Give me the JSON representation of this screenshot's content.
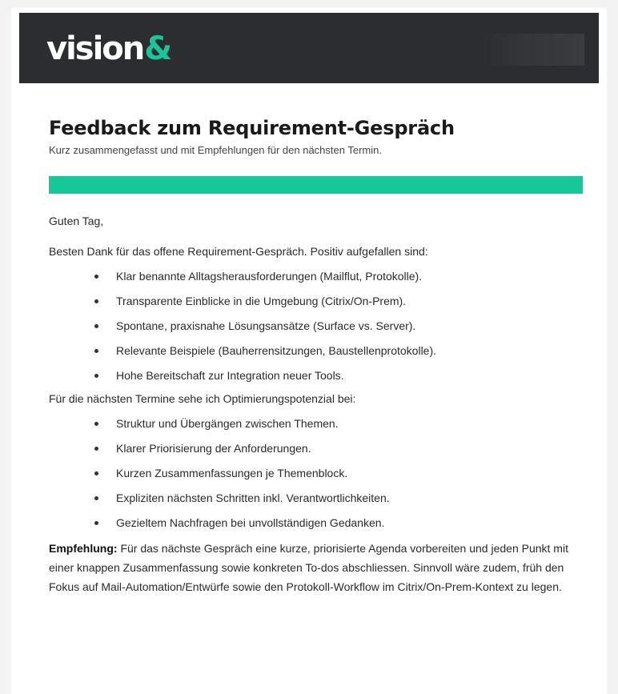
{
  "header": {
    "logo_text": "vision",
    "logo_amp": "&",
    "brand_color": "#16c79a",
    "banner_color": "#2b2d31"
  },
  "title": "Feedback zum Requirement-Gespräch",
  "subtitle": "Kurz zusammengefasst und mit Empfehlungen für den nächsten Termin.",
  "greeting": "Guten Tag,",
  "intro": "Besten Dank für das offene Requirement-Gespräch. Positiv aufgefallen sind:",
  "positives": [
    "Klar benannte Alltagsherausforderungen (Mailflut, Protokolle).",
    "Transparente Einblicke in die Umgebung (Citrix/On-Prem).",
    "Spontane, praxisnahe Lösungsansätze (Surface vs. Server).",
    "Relevante Beispiele (Bauherrensitzungen, Baustellenprotokolle).",
    "Hohe Bereitschaft zur Integration neuer Tools."
  ],
  "improvements_intro": "Für die nächsten Termine sehe ich Optimierungspotenzial bei:",
  "improvements": [
    "Struktur und Übergängen zwischen Themen.",
    "Klarer Priorisierung der Anforderungen.",
    "Kurzen Zusammenfassungen je Themenblock.",
    "Expliziten nächsten Schritten inkl. Verantwortlichkeiten.",
    "Gezieltem Nachfragen bei unvollständigen Gedanken."
  ],
  "recommendation": {
    "label": "Empfehlung:",
    "text": "Für das nächste Gespräch eine kurze, priorisierte Agenda vorbereiten und jeden Punkt mit einer knappen Zusammenfassung sowie konkreten To-dos abschliessen. Sinnvoll wäre zudem, früh den Fokus auf Mail-Automation/Entwürfe sowie den Protokoll-Workflow im Citrix/On-Prem-Kontext zu legen."
  }
}
